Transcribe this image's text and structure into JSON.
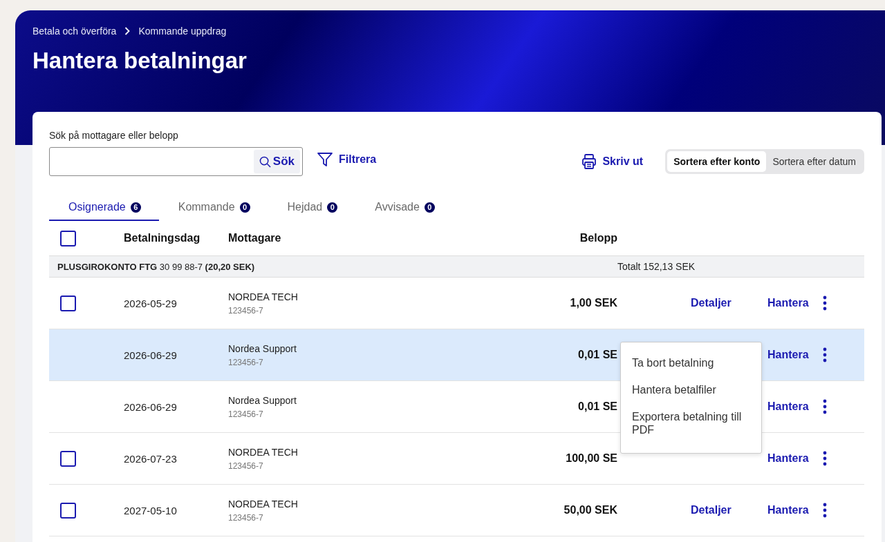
{
  "breadcrumb": [
    "Betala och överföra",
    "Kommande uppdrag"
  ],
  "title": "Hantera betalningar",
  "search": {
    "label": "Sök på mottagare eller belopp",
    "button": "Sök"
  },
  "filter_button": "Filtrera",
  "print_button": "Skriv ut",
  "sort_options": [
    {
      "label": "Sortera efter konto",
      "selected": true
    },
    {
      "label": "Sortera efter datum",
      "selected": false
    }
  ],
  "tabs": [
    {
      "label": "Osignerade",
      "count": "6",
      "selected": true
    },
    {
      "label": "Kommande",
      "count": "0",
      "selected": false
    },
    {
      "label": "Hejdad",
      "count": "0",
      "selected": false
    },
    {
      "label": "Avvisade",
      "count": "0",
      "selected": false
    }
  ],
  "table": {
    "select_all_checked": false,
    "columns": [
      "Betalningsdag",
      "Mottagare",
      "Belopp"
    ],
    "group": {
      "name": "PLUSGIROKONTO FTG",
      "number": "30 99 88-7",
      "balance": "(20,20 SEK)",
      "total": "Totalt 152,13 SEK"
    },
    "rows": [
      {
        "checked": false,
        "highlighted": false,
        "date": "2026-05-29",
        "recipient": "NORDEA TECH",
        "account": "123456-7",
        "amount": "1,00 SEK",
        "details": "Detaljer",
        "manage": "Hantera"
      },
      {
        "highlighted": true,
        "date": "2026-06-29",
        "recipient": "Nordea Support",
        "account": "123456-7",
        "amount": "0,01 SE",
        "manage": "Hantera",
        "menu": [
          "Ta bort betalning",
          "Hantera betalfiler",
          "Exportera betalning till PDF"
        ]
      },
      {
        "highlighted": false,
        "date": "2026-06-29",
        "recipient": "Nordea Support",
        "account": "123456-7",
        "amount": "0,01 SE",
        "manage": "Hantera"
      },
      {
        "checked": false,
        "highlighted": false,
        "date": "2026-07-23",
        "recipient": "NORDEA TECH",
        "account": "123456-7",
        "amount": "100,00 SE",
        "manage": "Hantera"
      },
      {
        "checked": false,
        "highlighted": false,
        "date": "2027-05-10",
        "recipient": "NORDEA TECH",
        "account": "123456-7",
        "amount": "50,00 SEK",
        "details": "Detaljer",
        "manage": "Hantera"
      }
    ]
  }
}
